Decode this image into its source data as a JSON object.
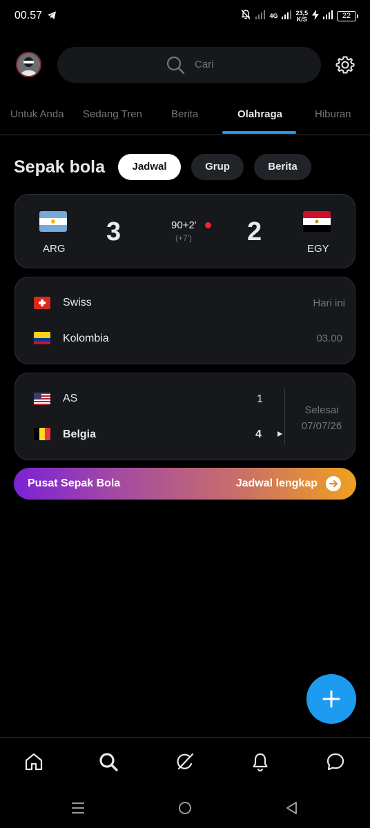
{
  "status_bar": {
    "time": "00.57",
    "network_type": "4G",
    "speed_value": "23,5",
    "speed_unit": "K/S",
    "battery": "22"
  },
  "header": {
    "search_placeholder": "Cari"
  },
  "tabs": [
    {
      "label": "Untuk Anda",
      "active": false
    },
    {
      "label": "Sedang Tren",
      "active": false
    },
    {
      "label": "Berita",
      "active": false
    },
    {
      "label": "Olahraga",
      "active": true
    },
    {
      "label": "Hiburan",
      "active": false
    }
  ],
  "section": {
    "title": "Sepak bola",
    "chips": [
      {
        "label": "Jadwal",
        "active": true
      },
      {
        "label": "Grup",
        "active": false
      },
      {
        "label": "Berita",
        "active": false
      }
    ]
  },
  "live_match": {
    "home_code": "ARG",
    "home_score": "3",
    "away_code": "EGY",
    "away_score": "2",
    "minute": "90+2'",
    "added_time": "(+7')"
  },
  "upcoming_match": {
    "team1": "Swiss",
    "team2": "Kolombia",
    "day": "Hari ini",
    "time": "03.00"
  },
  "finished_match": {
    "team1": "AS",
    "team1_score": "1",
    "team2": "Belgia",
    "team2_score": "4",
    "status": "Selesai",
    "date": "07/07/26"
  },
  "banner": {
    "title": "Pusat Sepak Bola",
    "link": "Jadwal lengkap"
  },
  "colors": {
    "accent": "#1d9bf0",
    "live": "#f4212e",
    "banner_start": "#7b22d6",
    "banner_end": "#f0a020"
  },
  "icons": {
    "nav": [
      "home-icon",
      "search-icon",
      "grok-icon",
      "notifications-icon",
      "messages-icon"
    ],
    "system": [
      "recent-apps-icon",
      "home-circle-icon",
      "back-icon"
    ]
  }
}
